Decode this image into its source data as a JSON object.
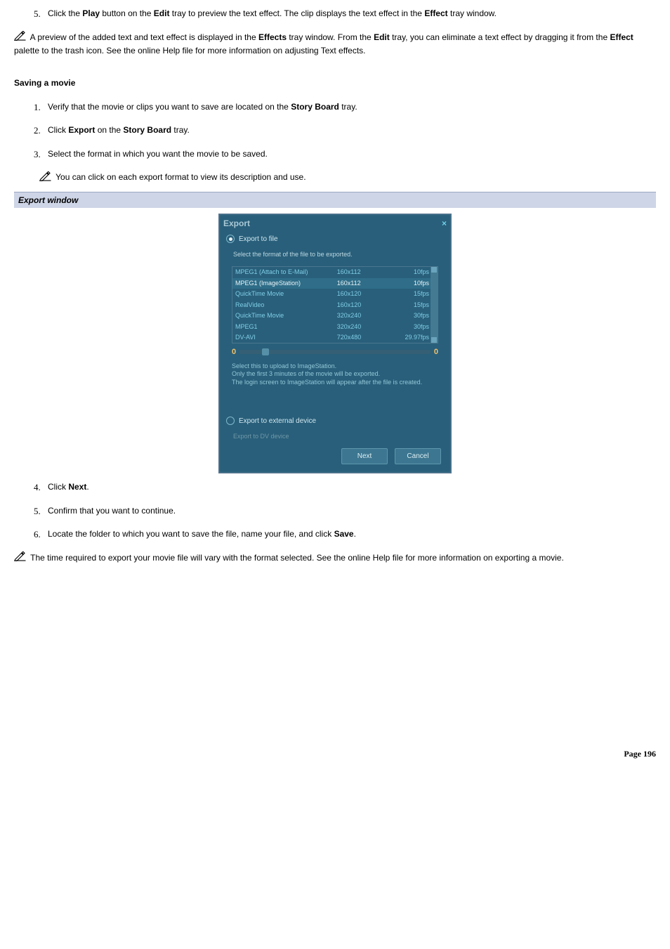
{
  "intro": {
    "step5": {
      "num": "5.",
      "pre": "Click the ",
      "b1": "Play",
      "mid1": " button on the ",
      "b2": "Edit",
      "mid2": " tray to preview the text effect. The clip displays the text effect in the ",
      "b3": "Effect",
      "tail": " tray window."
    },
    "note": {
      "pre": " A preview of the added text and text effect is displayed in the ",
      "b1": "Effects",
      "mid1": " tray window. From the ",
      "b2": "Edit",
      "mid2": " tray, you can eliminate a text effect by dragging it from the ",
      "b3": "Effect",
      "tail": " palette to the trash icon. See the online Help file for more information on adjusting Text effects."
    }
  },
  "saving": {
    "heading": "Saving a movie",
    "s1": {
      "num": "1.",
      "pre": "Verify that the movie or clips you want to save are located on the ",
      "b1": "Story Board",
      "tail": " tray."
    },
    "s2": {
      "num": "2.",
      "pre": "Click ",
      "b1": "Export",
      "mid": " on the ",
      "b2": "Story Board",
      "tail": " tray."
    },
    "s3": {
      "num": "3.",
      "text": "Select the format in which you want the movie to be saved."
    },
    "note1": " You can click on each export format to view its description and use.",
    "caption": "Export window",
    "s4": {
      "num": "4.",
      "pre": "Click ",
      "b1": "Next",
      "tail": "."
    },
    "s5": {
      "num": "5.",
      "text": "Confirm that you want to continue."
    },
    "s6": {
      "num": "6.",
      "pre": "Locate the folder to which you want to save the file, name your file, and click ",
      "b1": "Save",
      "tail": "."
    },
    "note2": " The time required to export your movie file will vary with the format selected. See the online Help file for more information on exporting a movie."
  },
  "export_dialog": {
    "title": "Export",
    "radio1": "Export to file",
    "sub_instr": "Select the format of the file to be exported.",
    "formats": [
      {
        "name": "MPEG1 (Attach to E-Mail)",
        "res": "160x112",
        "fps": "10fps"
      },
      {
        "name": "MPEG1 (ImageStation)",
        "res": "160x112",
        "fps": "10fps",
        "sel": true
      },
      {
        "name": "QuickTime Movie",
        "res": "160x120",
        "fps": "15fps"
      },
      {
        "name": "RealVideo",
        "res": "160x120",
        "fps": "15fps"
      },
      {
        "name": "QuickTime Movie",
        "res": "320x240",
        "fps": "30fps"
      },
      {
        "name": "MPEG1",
        "res": "320x240",
        "fps": "30fps"
      },
      {
        "name": "DV-AVI",
        "res": "720x480",
        "fps": "29.97fps"
      }
    ],
    "slider_left": "0",
    "slider_right": "0",
    "desc_l1": "Select this to upload to ImageStation.",
    "desc_l2": "Only the first 3 minutes of the movie will be exported.",
    "desc_l3": "The login screen to ImageStation will appear after the file is created.",
    "radio2": "Export to external device",
    "inactive": "Export to DV device",
    "btn_next": "Next",
    "btn_cancel": "Cancel"
  },
  "footer": "Page 196"
}
